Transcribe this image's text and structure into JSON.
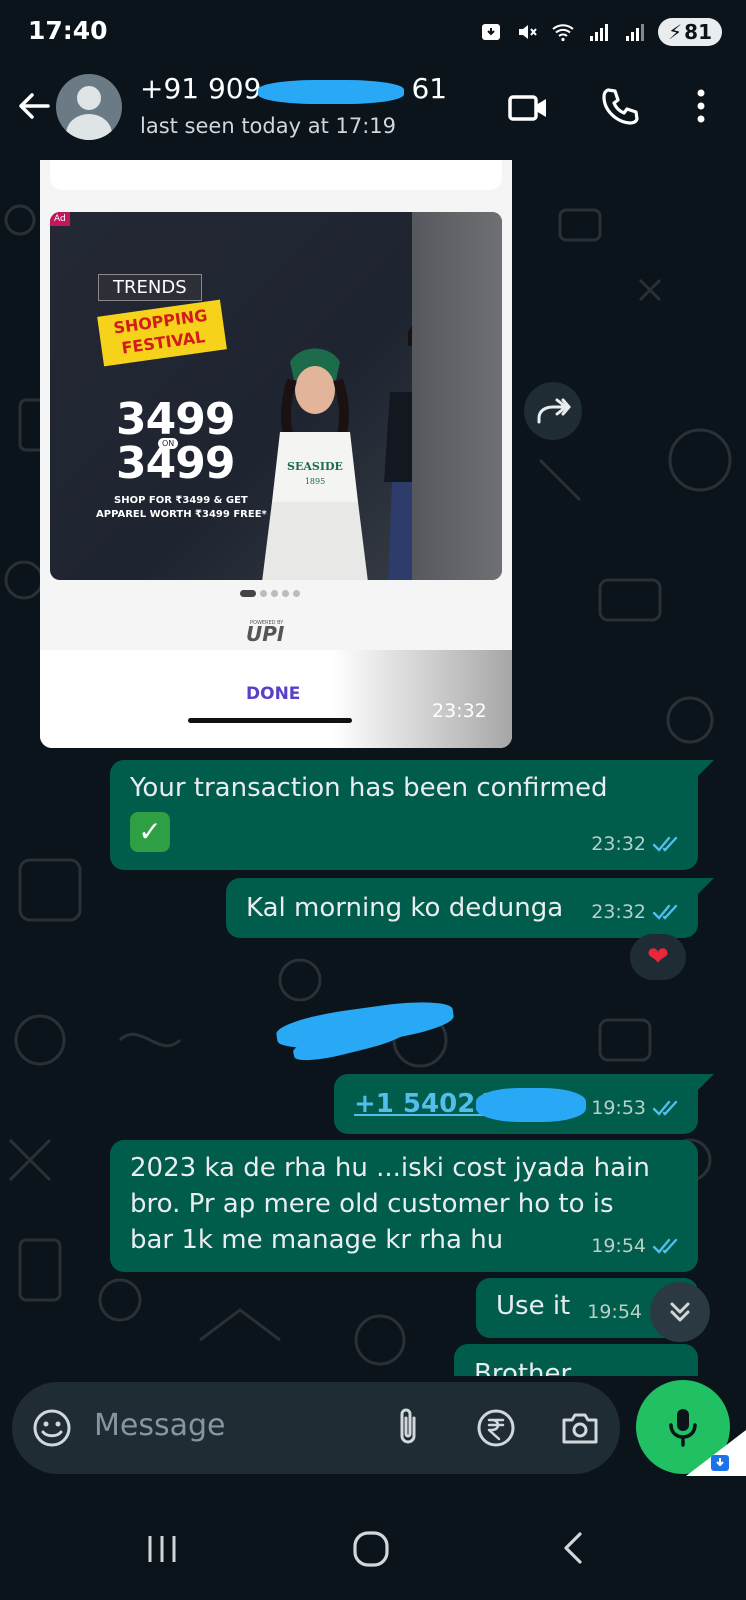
{
  "status_bar": {
    "time": "17:40",
    "battery": "81"
  },
  "header": {
    "contact_name": "+91 909",
    "contact_name_tail": "61",
    "last_seen": "last seen today at 17:19"
  },
  "image_message": {
    "ad_tag": "Ad",
    "brand_line1": "TRENDS",
    "brand_line2": "SHOPPING",
    "brand_line3": "FESTIVAL",
    "amount_top": "3499",
    "amount_on": "ON",
    "amount_bottom": "3499",
    "offer_line1": "SHOP FOR ₹3499 & GET",
    "offer_line2": "APPAREL WORTH ₹3499 FREE*",
    "tee_text": "SEASIDE",
    "tee_year": "1895",
    "powered_by": "POWERED BY",
    "upi_logo": "UPI",
    "done_label": "DONE",
    "time": "23:32"
  },
  "messages": [
    {
      "text": "Your transaction has been confirmed",
      "emoji": "✓",
      "time": "23:32"
    },
    {
      "text": "Kal morning ko dedunga",
      "time": "23:32",
      "reaction": "❤"
    },
    {
      "link": "+1 540242",
      "time": "19:53"
    },
    {
      "line1": "2023 ka de rha hu ...iski cost jyada hain",
      "line2": "bro. Pr ap mere old customer ho to is",
      "line3": "bar 1k me manage kr rha hu",
      "time": "19:54"
    },
    {
      "text": "Use it",
      "time": "19:54"
    },
    {
      "text": "Brother"
    }
  ],
  "input": {
    "placeholder": "Message"
  },
  "colors": {
    "background": "#0b141a",
    "outgoing_bubble": "#005c4b",
    "accent_green": "#21c063",
    "read_ticks": "#53bdeb"
  },
  "icons": [
    "back-arrow-icon",
    "avatar",
    "video-call-icon",
    "phone-icon",
    "more-options-icon",
    "forward-icon",
    "scroll-down-icon",
    "emoji-icon",
    "attach-icon",
    "rupee-payment-icon",
    "camera-icon",
    "mic-icon",
    "nav-recent-icon",
    "nav-home-icon",
    "nav-back-icon"
  ]
}
